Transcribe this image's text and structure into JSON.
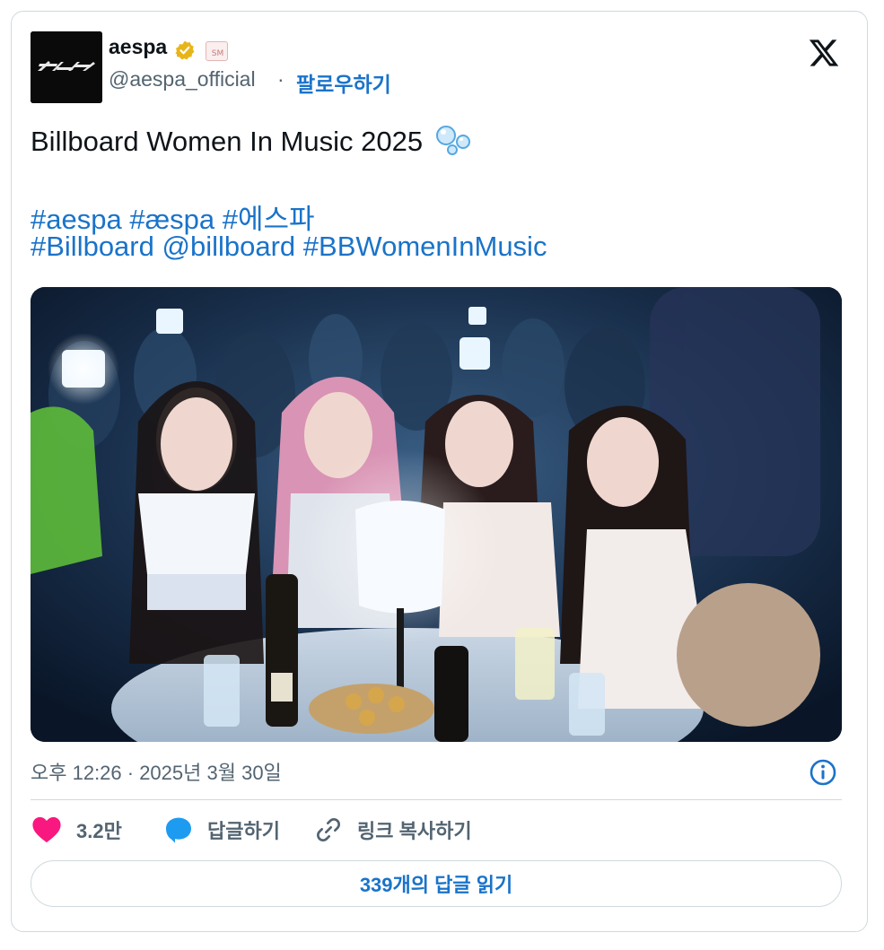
{
  "author": {
    "display_name": "aespa",
    "handle": "@aespa_official",
    "follow_label": "팔로우하기",
    "separator": "·",
    "logo_text": "æspa"
  },
  "tweet": {
    "text": "Billboard Women In Music 2025",
    "hashtags_line1": [
      "#aespa",
      "#æspa",
      "#에스파"
    ],
    "hashtags_line2": [
      "#Billboard",
      "@billboard",
      "#BBWomenInMusic"
    ],
    "timestamp": "오후 12:26 · 2025년 3월 30일"
  },
  "actions": {
    "likes": "3.2만",
    "reply_label": "답글하기",
    "copy_link_label": "링크 복사하기",
    "read_replies_label": "339개의 답글 읽기"
  },
  "colors": {
    "link": "#1a73c9",
    "like": "#f91880",
    "reply": "#1d9bf0",
    "verified": "#e8b518",
    "border": "#cfd9de"
  },
  "icons": [
    "verified-badge-icon",
    "x-logo-icon",
    "bubbles-emoji-icon",
    "info-icon",
    "heart-icon",
    "reply-bubble-icon",
    "link-icon"
  ]
}
